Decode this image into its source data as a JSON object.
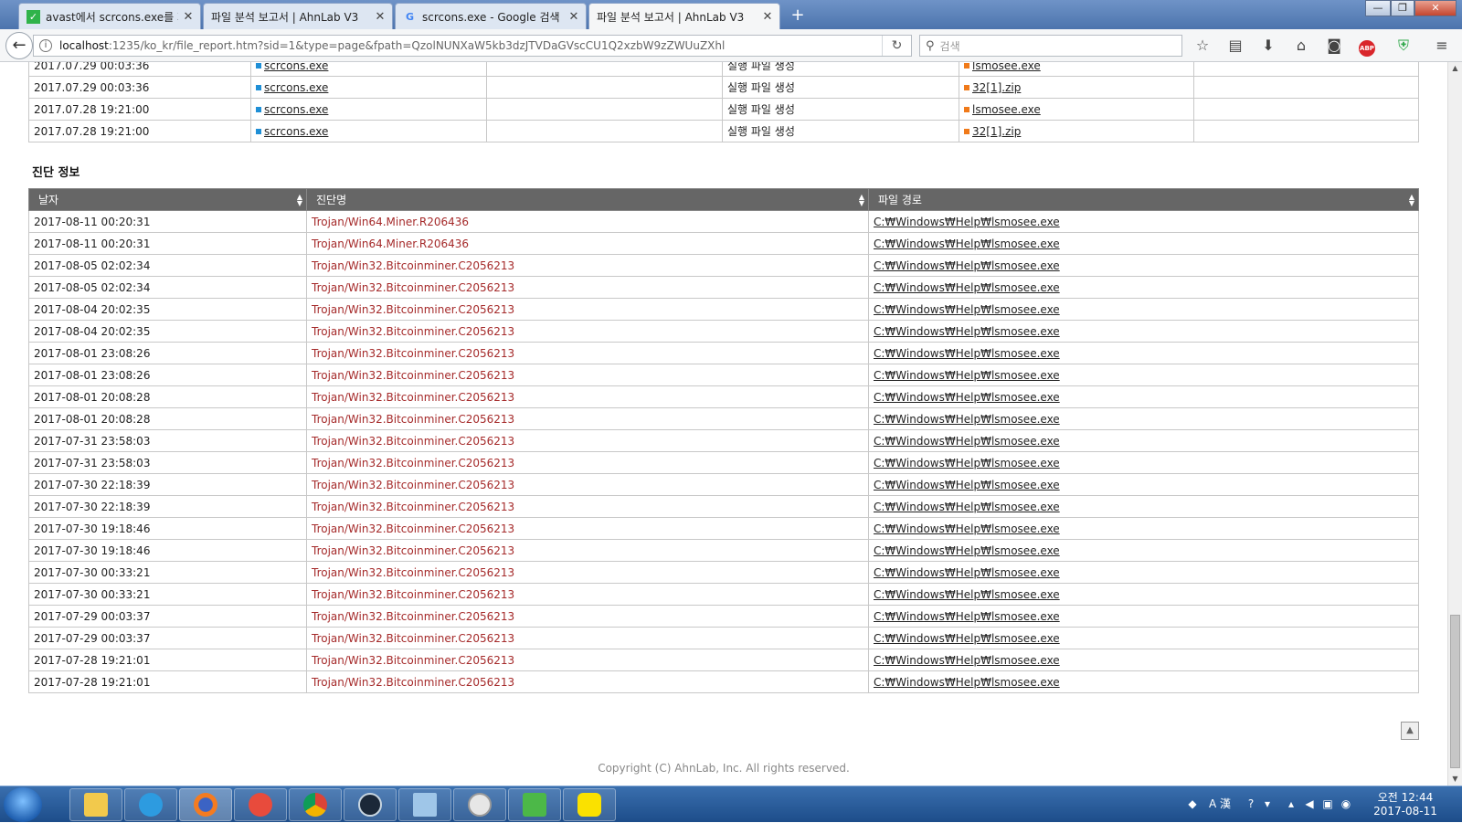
{
  "tabs": [
    {
      "title": "avast에서 scrcons.exe를 지속",
      "icon": "green-page-icon"
    },
    {
      "title": "파일 분석 보고서 | AhnLab V3",
      "icon": "none"
    },
    {
      "title": "scrcons.exe - Google 검색",
      "icon": "google-icon"
    },
    {
      "title": "파일 분석 보고서 | AhnLab V3",
      "icon": "none",
      "active": true
    }
  ],
  "window_buttons": {
    "minimize": "—",
    "restore": "❐",
    "close": "✕"
  },
  "nav": {
    "url_host": "localhost",
    "url_path": ":1235/ko_kr/file_report.htm?sid=1&type=page&fpath=QzolNUNXaW5kb3dzJTVDaGVscCU1Q2xzbW9zZWUuZXhl",
    "search_placeholder": "검색"
  },
  "activity_rows": [
    {
      "date": "2017.07.29 00:03:36",
      "process": "scrcons.exe",
      "blank": "",
      "action": "실행 파일 생성",
      "target": "lsmosee.exe",
      "extra": ""
    },
    {
      "date": "2017.07.29 00:03:36",
      "process": "scrcons.exe",
      "blank": "",
      "action": "실행 파일 생성",
      "target": "32[1].zip",
      "extra": ""
    },
    {
      "date": "2017.07.28 19:21:00",
      "process": "scrcons.exe",
      "blank": "",
      "action": "실행 파일 생성",
      "target": "lsmosee.exe",
      "extra": ""
    },
    {
      "date": "2017.07.28 19:21:00",
      "process": "scrcons.exe",
      "blank": "",
      "action": "실행 파일 생성",
      "target": "32[1].zip",
      "extra": ""
    }
  ],
  "diagnosis": {
    "title": "진단 정보",
    "headers": [
      "날자",
      "진단명",
      "파일 경로"
    ],
    "rows": [
      {
        "date": "2017-08-11 00:20:31",
        "name": "Trojan/Win64.Miner.R206436",
        "path": "C:₩Windows₩Help₩lsmosee.exe"
      },
      {
        "date": "2017-08-11 00:20:31",
        "name": "Trojan/Win64.Miner.R206436",
        "path": "C:₩Windows₩Help₩lsmosee.exe"
      },
      {
        "date": "2017-08-05 02:02:34",
        "name": "Trojan/Win32.Bitcoinminer.C2056213",
        "path": "C:₩Windows₩Help₩lsmosee.exe"
      },
      {
        "date": "2017-08-05 02:02:34",
        "name": "Trojan/Win32.Bitcoinminer.C2056213",
        "path": "C:₩Windows₩Help₩lsmosee.exe"
      },
      {
        "date": "2017-08-04 20:02:35",
        "name": "Trojan/Win32.Bitcoinminer.C2056213",
        "path": "C:₩Windows₩Help₩lsmosee.exe"
      },
      {
        "date": "2017-08-04 20:02:35",
        "name": "Trojan/Win32.Bitcoinminer.C2056213",
        "path": "C:₩Windows₩Help₩lsmosee.exe"
      },
      {
        "date": "2017-08-01 23:08:26",
        "name": "Trojan/Win32.Bitcoinminer.C2056213",
        "path": "C:₩Windows₩Help₩lsmosee.exe"
      },
      {
        "date": "2017-08-01 23:08:26",
        "name": "Trojan/Win32.Bitcoinminer.C2056213",
        "path": "C:₩Windows₩Help₩lsmosee.exe"
      },
      {
        "date": "2017-08-01 20:08:28",
        "name": "Trojan/Win32.Bitcoinminer.C2056213",
        "path": "C:₩Windows₩Help₩lsmosee.exe"
      },
      {
        "date": "2017-08-01 20:08:28",
        "name": "Trojan/Win32.Bitcoinminer.C2056213",
        "path": "C:₩Windows₩Help₩lsmosee.exe"
      },
      {
        "date": "2017-07-31 23:58:03",
        "name": "Trojan/Win32.Bitcoinminer.C2056213",
        "path": "C:₩Windows₩Help₩lsmosee.exe"
      },
      {
        "date": "2017-07-31 23:58:03",
        "name": "Trojan/Win32.Bitcoinminer.C2056213",
        "path": "C:₩Windows₩Help₩lsmosee.exe"
      },
      {
        "date": "2017-07-30 22:18:39",
        "name": "Trojan/Win32.Bitcoinminer.C2056213",
        "path": "C:₩Windows₩Help₩lsmosee.exe"
      },
      {
        "date": "2017-07-30 22:18:39",
        "name": "Trojan/Win32.Bitcoinminer.C2056213",
        "path": "C:₩Windows₩Help₩lsmosee.exe"
      },
      {
        "date": "2017-07-30 19:18:46",
        "name": "Trojan/Win32.Bitcoinminer.C2056213",
        "path": "C:₩Windows₩Help₩lsmosee.exe"
      },
      {
        "date": "2017-07-30 19:18:46",
        "name": "Trojan/Win32.Bitcoinminer.C2056213",
        "path": "C:₩Windows₩Help₩lsmosee.exe"
      },
      {
        "date": "2017-07-30 00:33:21",
        "name": "Trojan/Win32.Bitcoinminer.C2056213",
        "path": "C:₩Windows₩Help₩lsmosee.exe"
      },
      {
        "date": "2017-07-30 00:33:21",
        "name": "Trojan/Win32.Bitcoinminer.C2056213",
        "path": "C:₩Windows₩Help₩lsmosee.exe"
      },
      {
        "date": "2017-07-29 00:03:37",
        "name": "Trojan/Win32.Bitcoinminer.C2056213",
        "path": "C:₩Windows₩Help₩lsmosee.exe"
      },
      {
        "date": "2017-07-29 00:03:37",
        "name": "Trojan/Win32.Bitcoinminer.C2056213",
        "path": "C:₩Windows₩Help₩lsmosee.exe"
      },
      {
        "date": "2017-07-28 19:21:01",
        "name": "Trojan/Win32.Bitcoinminer.C2056213",
        "path": "C:₩Windows₩Help₩lsmosee.exe"
      },
      {
        "date": "2017-07-28 19:21:01",
        "name": "Trojan/Win32.Bitcoinminer.C2056213",
        "path": "C:₩Windows₩Help₩lsmosee.exe"
      }
    ]
  },
  "footer": {
    "copyright": "Copyright (C) AhnLab, Inc. All rights reserved."
  },
  "taskbar": {
    "items": [
      "explorer-icon",
      "internet-explorer-icon",
      "firefox-icon",
      "ccleaner-icon",
      "chrome-icon",
      "steam-icon",
      "notepad-icon",
      "speed-icon",
      "v3-icon",
      "kakaotalk-icon"
    ],
    "tray_ime": "A 漢",
    "clock_time": "오전 12:44",
    "clock_date": "2017-08-11"
  },
  "colors": {
    "detect_text": "#a52a2a",
    "header_bg": "#666666",
    "taskbar": "#1d4d8a"
  }
}
